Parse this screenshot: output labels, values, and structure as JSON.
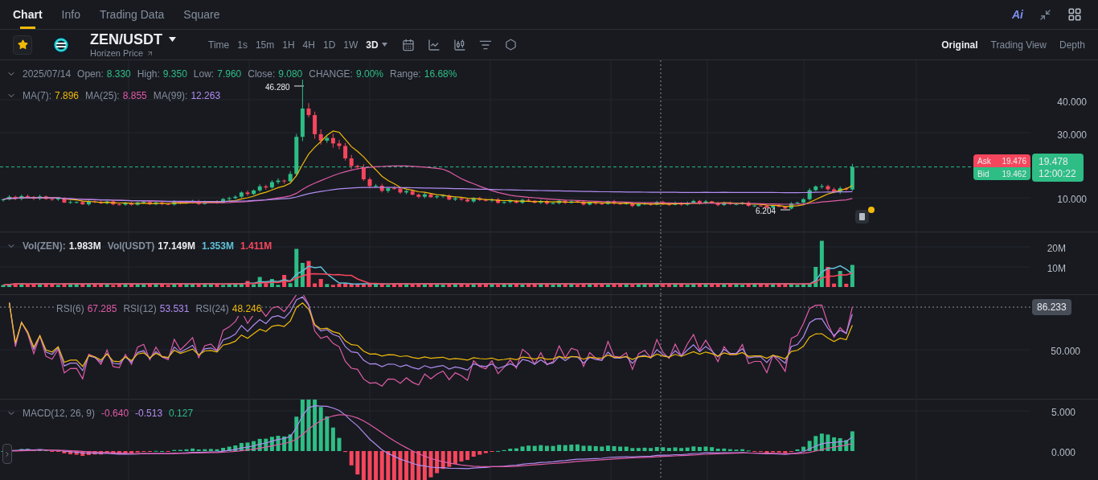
{
  "nav_tabs": [
    {
      "label": "Chart",
      "selected": true
    },
    {
      "label": "Info",
      "selected": false
    },
    {
      "label": "Trading Data",
      "selected": false
    },
    {
      "label": "Square",
      "selected": false
    }
  ],
  "ai_label": "Ai",
  "symbol": {
    "pair": "ZEN/USDT",
    "subtitle": "Horizen Price",
    "favorite": true
  },
  "intervals": [
    {
      "label": "Time",
      "selected": false
    },
    {
      "label": "1s",
      "selected": false
    },
    {
      "label": "15m",
      "selected": false
    },
    {
      "label": "1H",
      "selected": false
    },
    {
      "label": "4H",
      "selected": false
    },
    {
      "label": "1D",
      "selected": false
    },
    {
      "label": "1W",
      "selected": false
    },
    {
      "label": "3D",
      "selected": true
    }
  ],
  "view_modes": [
    {
      "label": "Original",
      "selected": true
    },
    {
      "label": "Trading View",
      "selected": false
    },
    {
      "label": "Depth",
      "selected": false
    }
  ],
  "price_pane": {
    "date": "2025/07/14",
    "fields": [
      {
        "label": "Open:",
        "value": "8.330"
      },
      {
        "label": "High:",
        "value": "9.350"
      },
      {
        "label": "Low:",
        "value": "7.960"
      },
      {
        "label": "Close:",
        "value": "9.080"
      },
      {
        "label": "CHANGE:",
        "value": "9.00%"
      },
      {
        "label": "Range:",
        "value": "16.68%"
      }
    ],
    "ma": [
      {
        "label": "MA(7):",
        "value": "7.896",
        "color": "#f0b90b"
      },
      {
        "label": "MA(25):",
        "value": "8.855",
        "color": "#e05ba5"
      },
      {
        "label": "MA(99):",
        "value": "12.263",
        "color": "#b18cf0"
      }
    ],
    "y_axis": [
      "40.000",
      "30.000",
      "10.000"
    ],
    "high_marker": "46.280",
    "low_marker": "6.204",
    "ask": {
      "label": "Ask",
      "value": "19.476"
    },
    "bid": {
      "label": "Bid",
      "value": "19.462"
    },
    "last": {
      "price": "19.478",
      "countdown": "12:00:22"
    }
  },
  "volume_pane": {
    "items": [
      {
        "label": "Vol(ZEN):",
        "value": "1.983M",
        "color": "#eaecef"
      },
      {
        "label": "Vol(USDT)",
        "value": "17.149M",
        "color": "#eaecef"
      },
      {
        "value": "1.353M",
        "color": "#5fc0d8"
      },
      {
        "value": "1.411M",
        "color": "#f6465d"
      }
    ],
    "y_axis": [
      "20M",
      "10M"
    ]
  },
  "rsi_pane": {
    "items": [
      {
        "label": "RSI(6)",
        "value": "67.285",
        "color": "#e05ba5"
      },
      {
        "label": "RSI(12)",
        "value": "53.531",
        "color": "#b18cf0"
      },
      {
        "label": "RSI(24)",
        "value": "48.246",
        "color": "#f0b90b"
      }
    ],
    "y_axis": [
      "50.000"
    ],
    "crosshair_value": "86.233"
  },
  "macd_pane": {
    "label": "MACD(12, 26, 9)",
    "items": [
      {
        "value": "-0.640",
        "color": "#e05ba5"
      },
      {
        "value": "-0.513",
        "color": "#b18cf0"
      },
      {
        "value": "0.127",
        "color": "#2ebd85"
      }
    ],
    "y_axis": [
      "5.000",
      "0.000"
    ]
  }
}
